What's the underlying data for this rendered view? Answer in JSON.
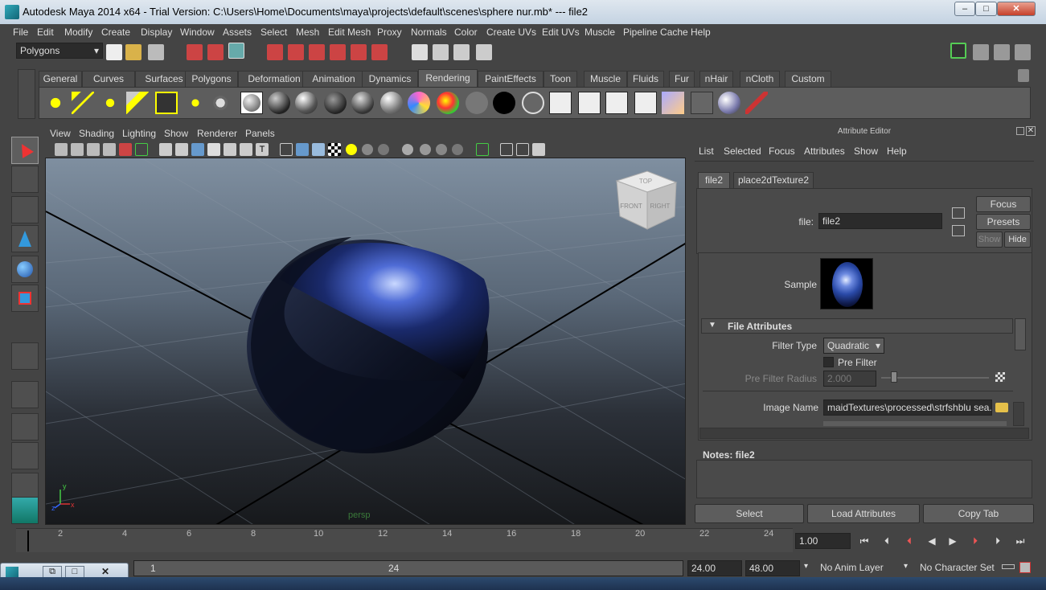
{
  "window": {
    "title": "Autodesk Maya 2014 x64 - Trial Version: C:\\Users\\Home\\Documents\\maya\\projects\\default\\scenes\\sphere nur.mb*  ---  file2",
    "min": "–",
    "max": "□",
    "close": "✕"
  },
  "menubar": [
    "File",
    "Edit",
    "Modify",
    "Create",
    "Display",
    "Window",
    "Assets",
    "Select",
    "Mesh",
    "Edit Mesh",
    "Proxy",
    "Normals",
    "Color",
    "Create UVs",
    "Edit UVs",
    "Muscle",
    "Pipeline Cache",
    "Help"
  ],
  "status_line": {
    "menuset": "Polygons"
  },
  "shelf": {
    "tabs": [
      "General",
      "Curves",
      "Surfaces",
      "Polygons",
      "Deformation",
      "Animation",
      "Dynamics",
      "Rendering",
      "PaintEffects",
      "Toon",
      "Muscle",
      "Fluids",
      "Fur",
      "nHair",
      "nCloth",
      "Custom"
    ],
    "active": "Rendering",
    "icons": [
      "ambient-light-icon",
      "directional-light-icon",
      "point-light-icon",
      "spot-light-icon",
      "area-light-icon",
      "volume-light-icon",
      "camera-icon",
      "lambert-icon",
      "blinn-icon",
      "phong-icon",
      "phong-e-icon",
      "anisotropic-icon",
      "layered-shader-icon",
      "ramp-shader-icon",
      "checker-icon",
      "gray-swatch-icon",
      "black-swatch-icon",
      "white-swatch-icon",
      "render-view-icon",
      "render-current-icon",
      "ipr-render-icon",
      "render-settings-icon",
      "hypershade-icon",
      "batch-render-icon",
      "render-layer-icon",
      "paint-icon"
    ]
  },
  "viewport": {
    "menus": [
      "View",
      "Shading",
      "Lighting",
      "Show",
      "Renderer",
      "Panels"
    ],
    "camera_label": "persp",
    "viewcube": {
      "top": "TOP",
      "front": "FRONT",
      "right": "RIGHT"
    },
    "axes": {
      "x": "x",
      "y": "y",
      "z": "z"
    }
  },
  "attribute_editor": {
    "title": "Attribute Editor",
    "menus": [
      "List",
      "Selected",
      "Focus",
      "Attributes",
      "Show",
      "Help"
    ],
    "tabs": [
      "file2",
      "place2dTexture2"
    ],
    "file_label": "file:",
    "file_value": "file2",
    "focus": "Focus",
    "presets": "Presets",
    "show": "Show",
    "hide": "Hide",
    "sample_label": "Sample",
    "section_title": "File Attributes",
    "filter_type_label": "Filter Type",
    "filter_type_value": "Quadratic",
    "pre_filter_label": "Pre Filter",
    "pre_filter_radius_label": "Pre Filter Radius",
    "pre_filter_radius_value": "2.000",
    "image_name_label": "Image Name",
    "image_name_value": "maidTextures\\processed\\strfshblu sea.png",
    "notes_label": "Notes:  file2",
    "select": "Select",
    "load_attributes": "Load Attributes",
    "copy_tab": "Copy Tab"
  },
  "timeline": {
    "ticks": [
      "2",
      "4",
      "6",
      "8",
      "10",
      "12",
      "14",
      "16",
      "18",
      "20",
      "22",
      "24"
    ],
    "current_time": "1.00"
  },
  "range": {
    "start": "1",
    "end_marker": "24",
    "playback_end": "24.00",
    "anim_end": "48.00",
    "anim_layer": "No Anim Layer",
    "character_set": "No Character Set"
  },
  "colors": {
    "accent": "#5285a6",
    "bg": "#444444"
  }
}
